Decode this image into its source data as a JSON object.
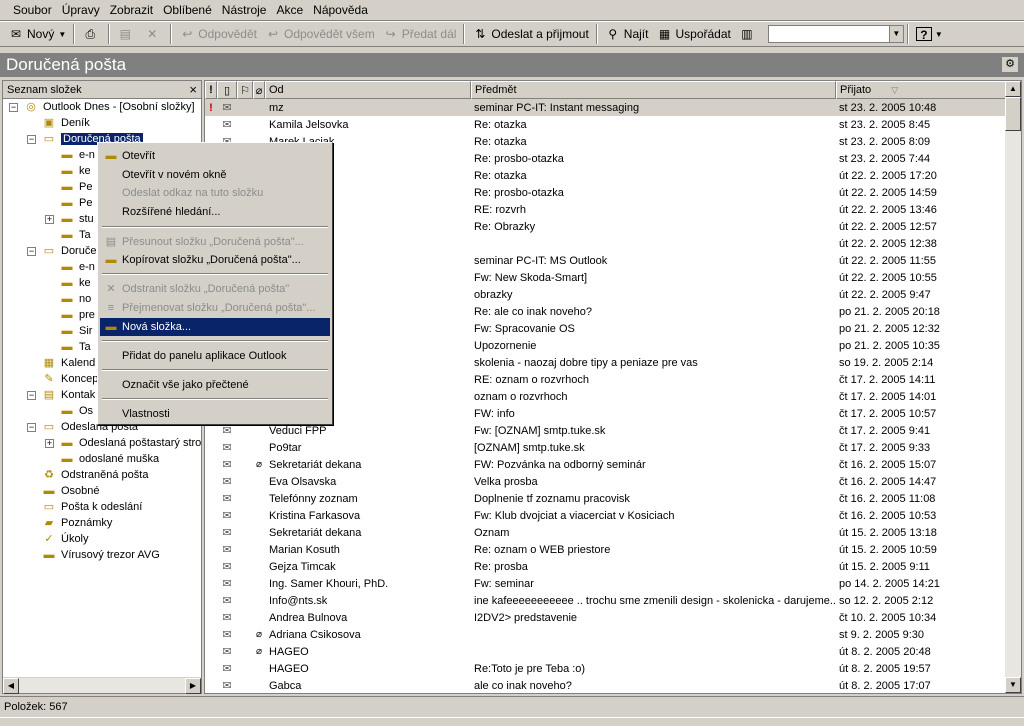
{
  "menu": [
    "Soubor",
    "Úpravy",
    "Zobrazit",
    "Oblíbené",
    "Nástroje",
    "Akce",
    "Nápověda"
  ],
  "toolbar": {
    "new_label": "Nový",
    "reply_label": "Odpovědět",
    "reply_all_label": "Odpovědět všem",
    "forward_label": "Předat dál",
    "send_receive_label": "Odeslat a přijmout",
    "find_label": "Najít",
    "organize_label": "Uspořádat",
    "help_label": "?"
  },
  "window_title": "Doručená pošta",
  "folder_pane": {
    "header": "Seznam složek",
    "close": "×",
    "items": [
      {
        "label": "Outlook Dnes - [Osobní složky]",
        "icon": "globe-icon"
      },
      {
        "label": "Deník",
        "icon": "journal-icon"
      },
      {
        "label": "Doručená pošta",
        "icon": "inbox-icon"
      },
      {
        "label": "e-n",
        "icon": "folder-icon"
      },
      {
        "label": "ke",
        "icon": "folder-icon"
      },
      {
        "label": "Pe",
        "icon": "folder-icon"
      },
      {
        "label": "Pe",
        "icon": "folder-icon"
      },
      {
        "label": "stu",
        "icon": "folder-icon"
      },
      {
        "label": "Ta",
        "icon": "folder-icon"
      },
      {
        "label": "Doruče",
        "icon": "inbox-icon"
      },
      {
        "label": "e-n",
        "icon": "folder-icon"
      },
      {
        "label": "ke",
        "icon": "folder-icon"
      },
      {
        "label": "no",
        "icon": "folder-icon"
      },
      {
        "label": "pre",
        "icon": "folder-icon"
      },
      {
        "label": "Sir",
        "icon": "folder-icon"
      },
      {
        "label": "Ta",
        "icon": "folder-icon"
      },
      {
        "label": "Kalend",
        "icon": "calendar-icon"
      },
      {
        "label": "Koncep",
        "icon": "drafts-icon"
      },
      {
        "label": "Kontak",
        "icon": "contacts-icon"
      },
      {
        "label": "Os",
        "icon": "folder-icon"
      },
      {
        "label": "Odeslaná pošta",
        "icon": "sent-icon"
      },
      {
        "label": "Odeslaná poštastarý stro",
        "icon": "folder-icon"
      },
      {
        "label": "odoslané muška",
        "icon": "folder-icon"
      },
      {
        "label": "Odstraněná pošta",
        "icon": "trash-icon"
      },
      {
        "label": "Osobné",
        "icon": "folder-icon"
      },
      {
        "label": "Pošta k odeslání",
        "icon": "outbox-icon"
      },
      {
        "label": "Poznámky",
        "icon": "notes-icon"
      },
      {
        "label": "Úkoly",
        "icon": "tasks-icon"
      },
      {
        "label": "Vírusový trezor AVG",
        "icon": "folder-icon"
      }
    ]
  },
  "columns": {
    "from": "Od",
    "subject": "Předmět",
    "received": "Přijato"
  },
  "messages": [
    {
      "from": "mz",
      "subject": "seminar PC-IT:  Instant messaging",
      "date": "st 23. 2. 2005 10:48",
      "important": true
    },
    {
      "from": "Kamila Jelsovka",
      "subject": "Re: otazka",
      "date": "st 23. 2. 2005 8:45"
    },
    {
      "from": "Marek Lacjak",
      "subject": "Re: otazka",
      "date": "st 23. 2. 2005 8:09"
    },
    {
      "from": "vičová",
      "subject": "Re: prosbo-otazka",
      "date": "st 23. 2. 2005 7:44"
    },
    {
      "from": "",
      "subject": "Re: otazka",
      "date": "út 22. 2. 2005 17:20"
    },
    {
      "from": "vičová",
      "subject": "Re: prosbo-otazka",
      "date": "út 22. 2. 2005 14:59"
    },
    {
      "from": "",
      "subject": "RE: rozvrh",
      "date": "út 22. 2. 2005 13:46"
    },
    {
      "from": "",
      "subject": "Re: Obrazky",
      "date": "út 22. 2. 2005 12:57"
    },
    {
      "from": "ssová",
      "subject": "",
      "date": "út 22. 2. 2005 12:38"
    },
    {
      "from": "",
      "subject": "seminar PC-IT: MS Outlook",
      "date": "út 22. 2. 2005 11:55"
    },
    {
      "from": "",
      "subject": "Fw: New Skoda-Smart]",
      "date": "út 22. 2. 2005 10:55"
    },
    {
      "from": "ova@tuke.sk",
      "subject": "obrazky",
      "date": "út 22. 2. 2005 9:47"
    },
    {
      "from": "",
      "subject": "Re: ale co inak noveho?",
      "date": "po 21. 2. 2005 20:18"
    },
    {
      "from": "houri, PhD.",
      "subject": "Fw: Spracovanie OS",
      "date": "po 21. 2. 2005 12:32"
    },
    {
      "from": "ková",
      "subject": "Upozornenie",
      "date": "po 21. 2. 2005 10:35"
    },
    {
      "from": "",
      "subject": "skolenia - naozaj dobre tipy a peniaze pre vas",
      "date": "so 19. 2. 2005 2:14"
    },
    {
      "from": "eleznik",
      "subject": "RE: oznam o rozvrhoch",
      "date": "čt 17. 2. 2005 14:11"
    },
    {
      "from": "nna",
      "subject": "oznam o rozvrhoch",
      "date": "čt 17. 2. 2005 14:01"
    },
    {
      "from": "ntosova",
      "subject": "FW: info",
      "date": "čt 17. 2. 2005 10:57"
    },
    {
      "from": "Veduci FPP",
      "subject": "Fw: [OZNAM] smtp.tuke.sk",
      "date": "čt 17. 2. 2005 9:41"
    },
    {
      "from": "Po9tar",
      "subject": "[OZNAM] smtp.tuke.sk",
      "date": "čt 17. 2. 2005 9:33"
    },
    {
      "from": "Sekretariát dekana",
      "subject": "FW: Pozvánka na odborný seminár",
      "date": "čt 16. 2. 2005 15:07",
      "attach": true
    },
    {
      "from": "Eva Olsavska",
      "subject": "Velka prosba",
      "date": "čt 16. 2. 2005 14:47"
    },
    {
      "from": "Telefónny zoznam",
      "subject": "Doplnenie tf zoznamu pracovisk",
      "date": "čt 16. 2. 2005 11:08"
    },
    {
      "from": "Kristina Farkasova",
      "subject": "Fw: Klub dvojciat a viacerciat v Kosiciach",
      "date": "čt 16. 2. 2005 10:53"
    },
    {
      "from": "Sekretariát dekana",
      "subject": "Oznam",
      "date": "út 15. 2. 2005 13:18"
    },
    {
      "from": "Marian Kosuth",
      "subject": "Re: oznam o WEB priestore",
      "date": "út 15. 2. 2005 10:59"
    },
    {
      "from": " Gejza Timcak",
      "subject": "Re: prosba",
      "date": "út 15. 2. 2005 9:11"
    },
    {
      "from": "Ing. Samer Khouri, PhD.",
      "subject": "Fw: seminar",
      "date": "po 14. 2. 2005 14:21"
    },
    {
      "from": "Info@nts.sk",
      "subject": "ine kafeeeeeeeeeee .. trochu sme zmenili design - skolenicka - darujeme...",
      "date": "so 12. 2. 2005 2:12"
    },
    {
      "from": "Andrea Bulnova",
      "subject": "I2DV2> predstavenie",
      "date": "čt 10. 2. 2005 10:34"
    },
    {
      "from": "Adriana Csikosova",
      "subject": "",
      "date": "st 9. 2. 2005 9:30",
      "attach": true
    },
    {
      "from": "HAGEO",
      "subject": "",
      "date": "út 8. 2. 2005 20:48",
      "attach": true
    },
    {
      "from": "HAGEO",
      "subject": "Re:Toto je pre Teba :o)",
      "date": "út 8. 2. 2005 19:57"
    },
    {
      "from": "Gabca",
      "subject": "ale co inak noveho?",
      "date": "út 8. 2. 2005 17:07"
    }
  ],
  "context_menu": [
    {
      "label": "Otevřít",
      "disabled": false,
      "icon": "open-folder-icon"
    },
    {
      "label": "Otevřít v novém okně",
      "disabled": false
    },
    {
      "label": "Odeslat odkaz na tuto složku",
      "disabled": true
    },
    {
      "label": "Rozšířené hledání...",
      "disabled": false
    },
    {
      "label": "Přesunout složku „Doručená pošta\"...",
      "disabled": true,
      "icon": "move-folder-icon"
    },
    {
      "label": "Kopírovat složku „Doručená pošta\"...",
      "disabled": false,
      "icon": "copy-folder-icon"
    },
    {
      "label": "Odstranit složku „Doručená pošta\"",
      "disabled": true,
      "icon": "delete-folder-icon"
    },
    {
      "label": "Přejmenovat složku „Doručená pošta\"...",
      "disabled": true,
      "icon": "rename-folder-icon"
    },
    {
      "label": "Nová složka...",
      "disabled": false,
      "highlighted": true,
      "icon": "new-folder-icon"
    },
    {
      "label": "Přidat do panelu aplikace Outlook",
      "disabled": false
    },
    {
      "label": "Označit vše jako přečtené",
      "disabled": false
    },
    {
      "label": "Vlastnosti",
      "disabled": false
    }
  ],
  "status": {
    "items_label": "Položek: 567"
  }
}
